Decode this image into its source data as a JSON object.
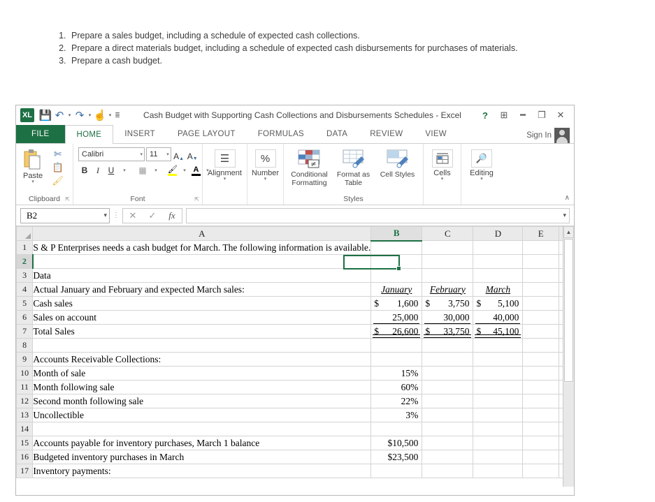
{
  "instructions": [
    "Prepare a sales budget, including a schedule of expected cash collections.",
    "Prepare a direct materials budget, including a schedule of expected cash disbursements for purchases of materials.",
    "Prepare a cash budget."
  ],
  "window": {
    "title": "Cash Budget with Supporting Cash Collections and Disbursements Schedules - Excel",
    "logo": "XL",
    "help_label": "?",
    "ribbon_display_label": "⬆",
    "minimize_label": "—",
    "restore_label": "❐",
    "close_label": "✕",
    "quick_access": {
      "save": "💾",
      "undo": "↶",
      "redo": "↷",
      "touch": "☝",
      "more": "☰"
    }
  },
  "tabs": [
    {
      "label": "FILE",
      "active": false
    },
    {
      "label": "HOME",
      "active": true
    },
    {
      "label": "INSERT",
      "active": false
    },
    {
      "label": "PAGE LAYOUT",
      "active": false
    },
    {
      "label": "FORMULAS",
      "active": false
    },
    {
      "label": "DATA",
      "active": false
    },
    {
      "label": "REVIEW",
      "active": false
    },
    {
      "label": "VIEW",
      "active": false
    }
  ],
  "account": {
    "sign_in_label": "Sign In"
  },
  "ribbon": {
    "clipboard": {
      "group_label": "Clipboard",
      "paste_label": "Paste",
      "cut_label": "✂",
      "copy_label": "❐",
      "format_painter_label": "🖌",
      "launcher": "⤵"
    },
    "font": {
      "group_label": "Font",
      "font_name": "Calibri",
      "font_size": "11",
      "grow_font_label": "A",
      "shrink_font_label": "A",
      "bold_label": "B",
      "italic_label": "I",
      "underline_label": "U",
      "borders_label": "▦",
      "fill_color_label": "⬛",
      "font_color_label": "A",
      "launcher": "⤵"
    },
    "alignment": {
      "group_label": "Alignment",
      "icon_label": "☰"
    },
    "number": {
      "group_label": "Number",
      "icon_label": "%"
    },
    "styles": {
      "group_label": "Styles",
      "conditional_formatting_label": "Conditional Formatting",
      "format_as_table_label": "Format as Table",
      "cell_styles_label": "Cell Styles"
    },
    "cells": {
      "group_label": "Cells",
      "label": "Cells"
    },
    "editing": {
      "group_label": "Editing",
      "label": "Editing",
      "icon_label": "⌕"
    },
    "collapse_label": "∧",
    "dropdown_caret": "▾"
  },
  "formula_bar": {
    "name_box_value": "B2",
    "name_box_caret": "∨",
    "cancel_label": "✕",
    "enter_label": "✓",
    "fx_label": "fx",
    "formula_value": "",
    "expand_label": "∨"
  },
  "sheet": {
    "columns": [
      "A",
      "B",
      "C",
      "D",
      "E",
      ""
    ],
    "selected_cell": "B2",
    "selected_column": "B",
    "selected_row": "2",
    "rows": [
      {
        "n": "1",
        "a": "S & P Enterprises needs a cash budget for March. The following information is available.",
        "b": "",
        "c": "",
        "d": ""
      },
      {
        "n": "2",
        "a": "",
        "b": "",
        "c": "",
        "d": ""
      },
      {
        "n": "3",
        "a": "Data",
        "b": "",
        "c": "",
        "d": ""
      },
      {
        "n": "4",
        "a": "Actual January and February and expected March sales:",
        "b": "January",
        "c": "February",
        "d": "March"
      },
      {
        "n": "5",
        "a": "Cash sales",
        "b": "1,600",
        "c": "3,750",
        "d": "5,100"
      },
      {
        "n": "6",
        "a": "Sales on account",
        "b": "25,000",
        "c": "30,000",
        "d": "40,000"
      },
      {
        "n": "7",
        "a": "Total Sales",
        "b": "26,600",
        "c": "33,750",
        "d": "45,100"
      },
      {
        "n": "8",
        "a": "",
        "b": "",
        "c": "",
        "d": ""
      },
      {
        "n": "9",
        "a": "Accounts Receivable Collections:",
        "b": "",
        "c": "",
        "d": ""
      },
      {
        "n": "10",
        "a": "Month of sale",
        "b": "15%",
        "c": "",
        "d": ""
      },
      {
        "n": "11",
        "a": "Month following sale",
        "b": "60%",
        "c": "",
        "d": ""
      },
      {
        "n": "12",
        "a": "Second month following sale",
        "b": "22%",
        "c": "",
        "d": ""
      },
      {
        "n": "13",
        "a": "Uncollectible",
        "b": "3%",
        "c": "",
        "d": ""
      },
      {
        "n": "14",
        "a": "",
        "b": "",
        "c": "",
        "d": ""
      },
      {
        "n": "15",
        "a": "Accounts payable for inventory purchases, March 1 balance",
        "b": "$10,500",
        "c": "",
        "d": ""
      },
      {
        "n": "16",
        "a": "Budgeted inventory purchases in March",
        "b": "$23,500",
        "c": "",
        "d": ""
      },
      {
        "n": "17",
        "a": "Inventory payments:",
        "b": "",
        "c": "",
        "d": ""
      }
    ],
    "currency_symbol": "$",
    "scrollbar": {
      "up_arrow": "▲"
    }
  },
  "colors": {
    "excel_green": "#1d7044",
    "header_gray": "#eaeaea",
    "grid_line": "#d4d4d4"
  }
}
